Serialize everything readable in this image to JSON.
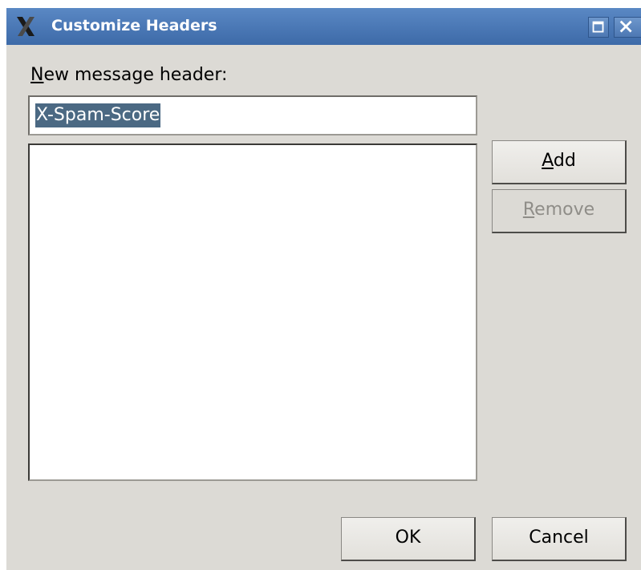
{
  "window": {
    "title": "Customize Headers"
  },
  "form": {
    "new_header_label_mnemonic": "N",
    "new_header_label_rest": "ew message header:",
    "new_header_value": "X-Spam-Score",
    "headers_list": []
  },
  "buttons": {
    "add_mnemonic": "A",
    "add_rest": "dd",
    "remove_mnemonic": "R",
    "remove_rest": "emove",
    "remove_enabled": false,
    "ok": "OK",
    "cancel": "Cancel"
  },
  "colors": {
    "titlebar": "#4a78b8",
    "selection": "#4b6983",
    "dialog_bg": "#dcdad5"
  }
}
